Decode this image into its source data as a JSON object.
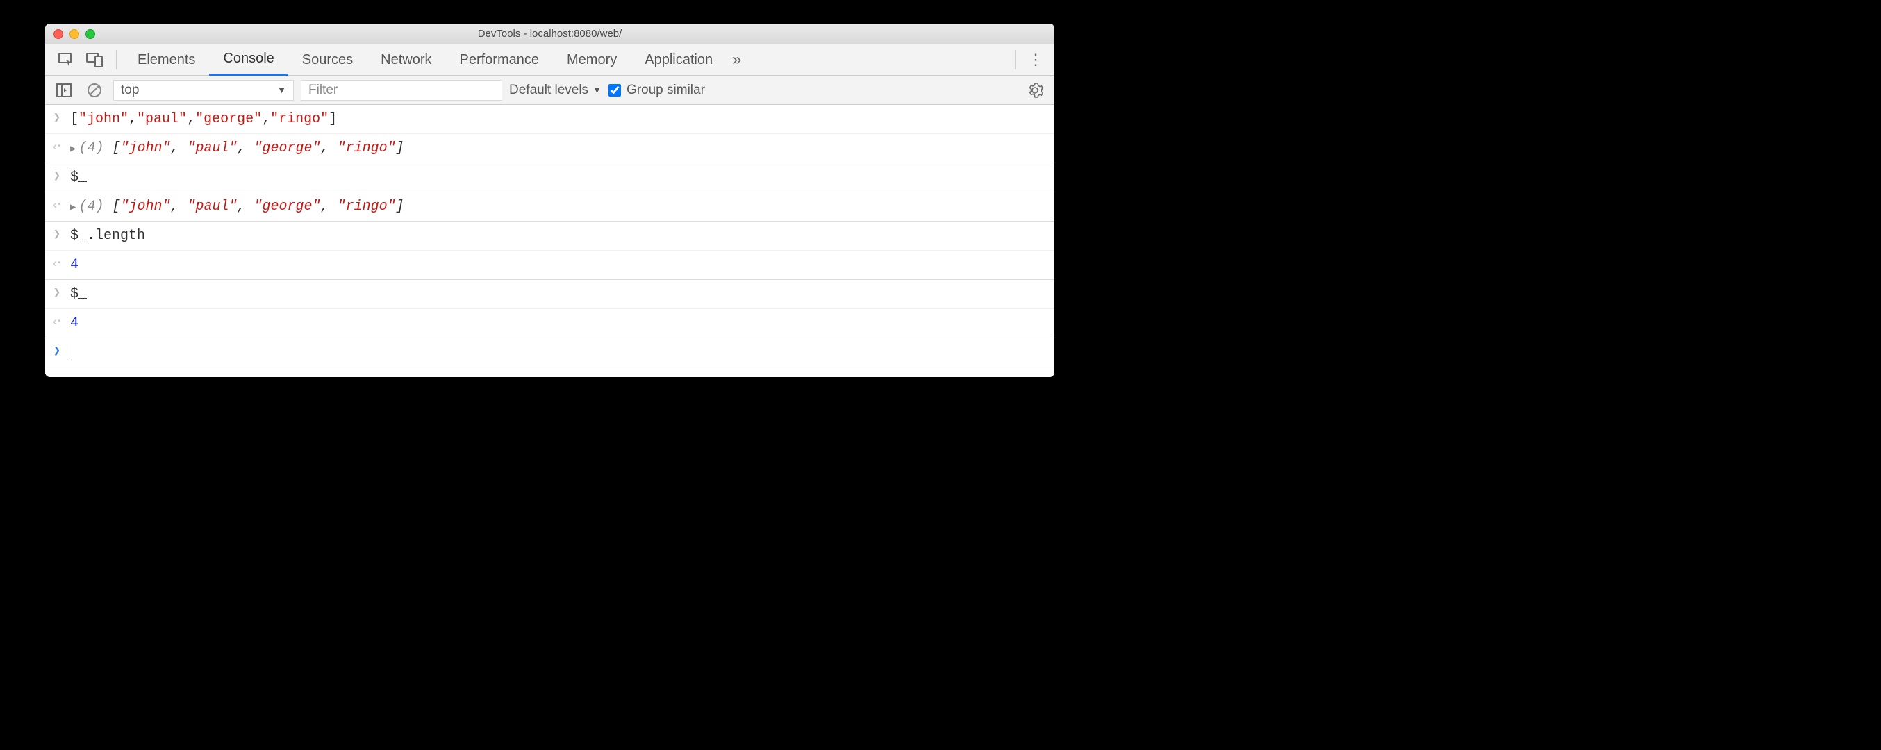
{
  "window": {
    "title": "DevTools - localhost:8080/web/"
  },
  "tabs": {
    "items": [
      "Elements",
      "Console",
      "Sources",
      "Network",
      "Performance",
      "Memory",
      "Application"
    ],
    "active": "Console"
  },
  "toolbar": {
    "context": "top",
    "filter_placeholder": "Filter",
    "levels_label": "Default levels",
    "group_label": "Group similar",
    "group_checked": true
  },
  "console": {
    "rows": [
      {
        "kind": "input",
        "text": "[\"john\",\"paul\",\"george\",\"ringo\"]"
      },
      {
        "kind": "result",
        "expand": true,
        "count": "(4)",
        "preview": "[\"john\", \"paul\", \"george\", \"ringo\"]",
        "sep": true
      },
      {
        "kind": "input",
        "text": "$_"
      },
      {
        "kind": "result",
        "expand": true,
        "count": "(4)",
        "preview": "[\"john\", \"paul\", \"george\", \"ringo\"]",
        "sep": true
      },
      {
        "kind": "input",
        "text": "$_.length"
      },
      {
        "kind": "result",
        "number": "4",
        "sep": true
      },
      {
        "kind": "input",
        "text": "$_"
      },
      {
        "kind": "result",
        "number": "4",
        "sep": true
      },
      {
        "kind": "prompt"
      }
    ]
  }
}
